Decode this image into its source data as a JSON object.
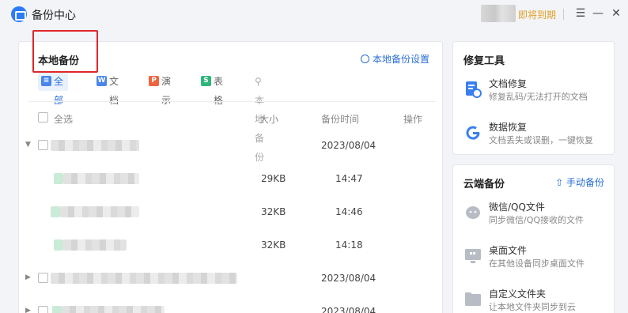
{
  "app": {
    "title": "备份中心",
    "expire_label": "即将到期",
    "menu_icon": "menu-icon",
    "min_icon": "minimize-icon",
    "close_icon": "close-icon"
  },
  "local": {
    "title": "本地备份",
    "settings_label": "本地备份设置",
    "filters": [
      {
        "label": "全部",
        "color": "#4a86e8",
        "glyph": "≡"
      },
      {
        "label": "文档",
        "color": "#4a86e8",
        "glyph": "W"
      },
      {
        "label": "演示",
        "color": "#f0633e",
        "glyph": "P"
      },
      {
        "label": "表格",
        "color": "#2fb67b",
        "glyph": "S"
      }
    ],
    "search_placeholder": "本地备份",
    "columns": {
      "select_all": "全选",
      "size": "大小",
      "time": "备份时间",
      "action": "操作"
    },
    "rows": [
      {
        "size": "",
        "time": "2023/08/04",
        "expanded": true
      },
      {
        "size": "29KB",
        "time": "14:47"
      },
      {
        "size": "32KB",
        "time": "14:46"
      },
      {
        "size": "32KB",
        "time": "14:18"
      },
      {
        "size": "",
        "time": "2023/08/04",
        "expanded": false
      },
      {
        "size": "",
        "time": "2023/08/04",
        "expanded": false
      }
    ]
  },
  "tools": {
    "title": "修复工具",
    "items": [
      {
        "title": "文档修复",
        "desc": "修复乱码/无法打开的文档",
        "icon": "document-repair-icon"
      },
      {
        "title": "数据恢复",
        "desc": "文档丢失或误删，一键恢复",
        "icon": "data-recovery-icon"
      }
    ]
  },
  "cloud": {
    "title": "云端备份",
    "manual_label": "手动备份",
    "items": [
      {
        "title": "微信/QQ文件",
        "desc": "同步微信/QQ接收的文件",
        "icon": "chat-file-icon"
      },
      {
        "title": "桌面文件",
        "desc": "在其他设备同步桌面文件",
        "icon": "desktop-icon"
      },
      {
        "title": "自定义文件夹",
        "desc": "让本地文件夹同步到云",
        "icon": "folder-icon"
      }
    ]
  }
}
